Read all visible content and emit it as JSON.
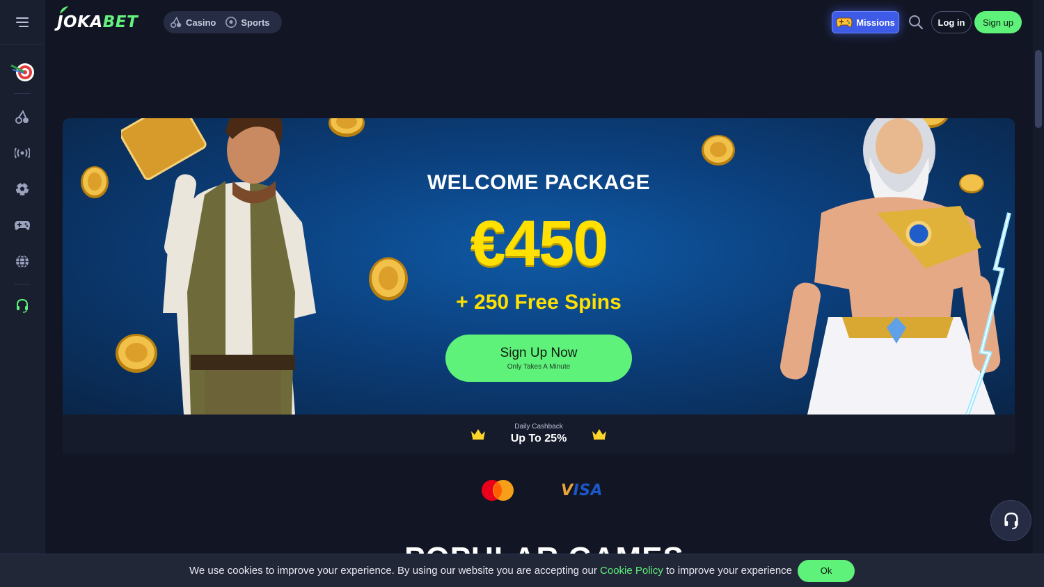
{
  "brand": {
    "logo_main": "JOKA",
    "logo_accent": "BET"
  },
  "nav": {
    "casino_label": "Casino",
    "sports_label": "Sports"
  },
  "header": {
    "missions_label": "Missions",
    "login_label": "Log in",
    "signup_label": "Sign up"
  },
  "sidebar": {
    "items": [
      {
        "icon": "target-darts-icon"
      },
      {
        "icon": "cherry-icon"
      },
      {
        "icon": "live-broadcast-icon"
      },
      {
        "icon": "soccer-ball-icon"
      },
      {
        "icon": "gamepad-icon"
      },
      {
        "icon": "globe-icon"
      },
      {
        "icon": "headset-icon"
      }
    ]
  },
  "banner": {
    "title": "WELCOME PACKAGE",
    "amount": "€450",
    "spins": "+ 250 Free Spins",
    "cta_main": "Sign Up Now",
    "cta_sub": "Only Takes A Minute"
  },
  "cashback": {
    "label": "Daily Cashback",
    "value": "Up To 25%"
  },
  "payments": {
    "visa_label": "VISA"
  },
  "popular": {
    "title": "POPULAR GAMES"
  },
  "cookie": {
    "text_before": "We use cookies to improve your experience. By using our website you are accepting our",
    "link_label": "Cookie Policy",
    "text_after": "to improve your experience",
    "ok_label": "Ok"
  },
  "colors": {
    "accent_green": "#5ff27a",
    "highlight_yellow": "#ffe000",
    "missions_blue": "#3d5be6",
    "background": "#121624"
  }
}
